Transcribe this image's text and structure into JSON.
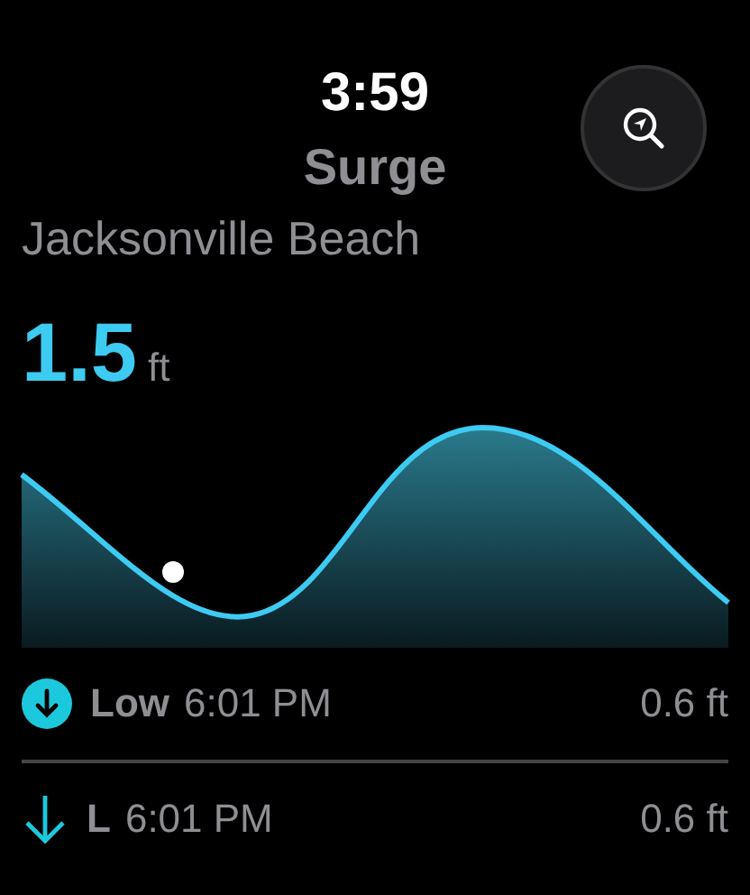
{
  "status_bar": {
    "time": "3:59"
  },
  "header": {
    "title": "Surge",
    "location": "Jacksonville Beach"
  },
  "reading": {
    "value": "1.5",
    "unit": "ft"
  },
  "tides": [
    {
      "kind": "circle",
      "label": "Low",
      "time": "6:01 PM",
      "height": "0.6 ft"
    },
    {
      "kind": "plain",
      "label": "L",
      "time": "6:01 PM",
      "height": "0.6 ft"
    }
  ]
}
